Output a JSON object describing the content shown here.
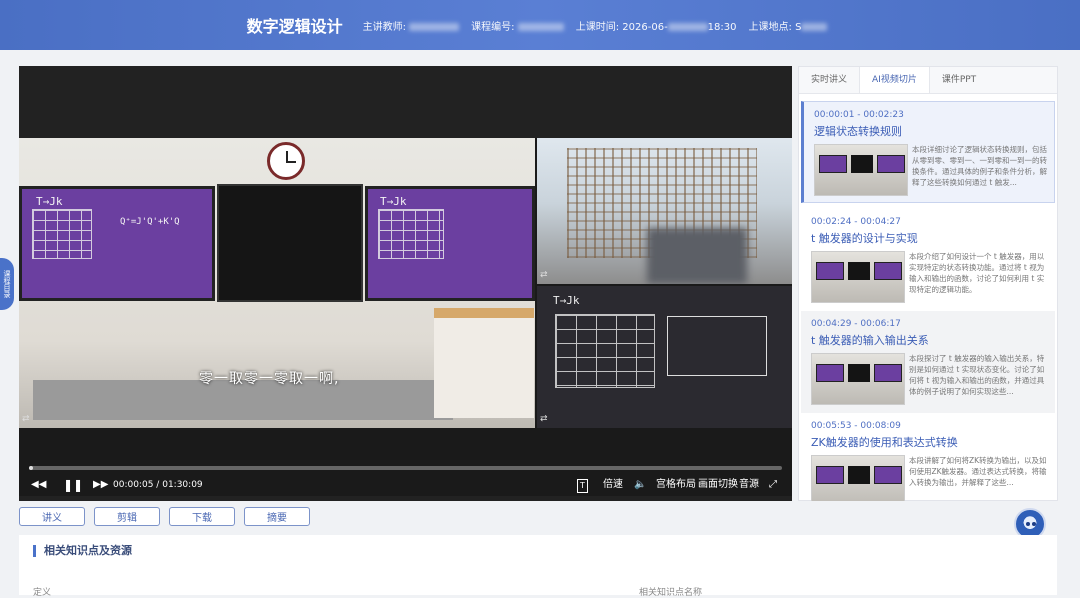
{
  "header": {
    "course_title": "数字逻辑设计",
    "teacher_label": "主讲教师:",
    "course_code_label": "课程编号:",
    "class_time_label": "上课时间:",
    "class_time_value_start": "2026-06-",
    "class_time_value_end": "18:30",
    "location_label": "上课地点:",
    "location_value_start": "S"
  },
  "video": {
    "subtitle": "零一取零一零取一啊,",
    "board_left_text": "T→Jk",
    "board_formula": "Q⁺=J'Q'+K'Q",
    "board_right_text": "T→Jk",
    "cam_board_text": "T→Jk",
    "current_time": "00:00:05",
    "time_separator": "/",
    "total_time": "01:30:09",
    "progress_fraction": 0.0009
  },
  "controls": {
    "speed_label": "倍速",
    "layout_label": "宫格布局",
    "switch_label": "画面切换",
    "audio_label": "音源"
  },
  "actions": [
    "讲义",
    "剪辑",
    "下载",
    "摘要"
  ],
  "panel": {
    "tabs": [
      "实时讲义",
      "AI视频切片",
      "课件PPT"
    ],
    "active_tab": 1,
    "clips": [
      {
        "time": "00:00:01 - 00:02:23",
        "title": "逻辑状态转换规则",
        "desc": "本段详细讨论了逻辑状态转换规则，包括从零到零、零到一、一到零和一到一的转换条件。通过具体的例子和条件分析，解释了这些转换如何通过 t 触发..."
      },
      {
        "time": "00:02:24 - 00:04:27",
        "title": "t 触发器的设计与实现",
        "desc": "本段介绍了如何设计一个 t 触发器，用以实现特定的状态转换功能。通过将 t 视为输入和输出的函数，讨论了如何利用 t 实现特定的逻辑功能。"
      },
      {
        "time": "00:04:29 - 00:06:17",
        "title": "t 触发器的输入输出关系",
        "desc": "本段探讨了 t 触发器的输入输出关系，特别是如何通过 t 实现状态变化。讨论了如何将 t 视为输入和输出的函数，并通过具体的例子说明了如何实现这些..."
      },
      {
        "time": "00:05:53 - 00:08:09",
        "title": "ZK触发器的使用和表达式转换",
        "desc": "本段讲解了如何将ZK转换为输出，以及如何使用ZK触发器。通过表达式转换，将输入转换为输出，并解释了这些..."
      }
    ]
  },
  "side_tab_label": "课程目录",
  "resources": {
    "title": "相关知识点及资源",
    "col_left": "定义",
    "col_right": "相关知识点名称"
  },
  "colors": {
    "header_bg": "#4a6fc4",
    "accent": "#4866b2",
    "clip_title": "#3a5cb5"
  },
  "icons": {
    "rewind": "rewind-icon",
    "pause": "pause-icon",
    "forward": "fast-forward-icon",
    "subtitle": "subtitle-icon",
    "volume": "volume-icon",
    "fullscreen": "fullscreen-icon",
    "assistant": "robot-assistant-icon"
  }
}
